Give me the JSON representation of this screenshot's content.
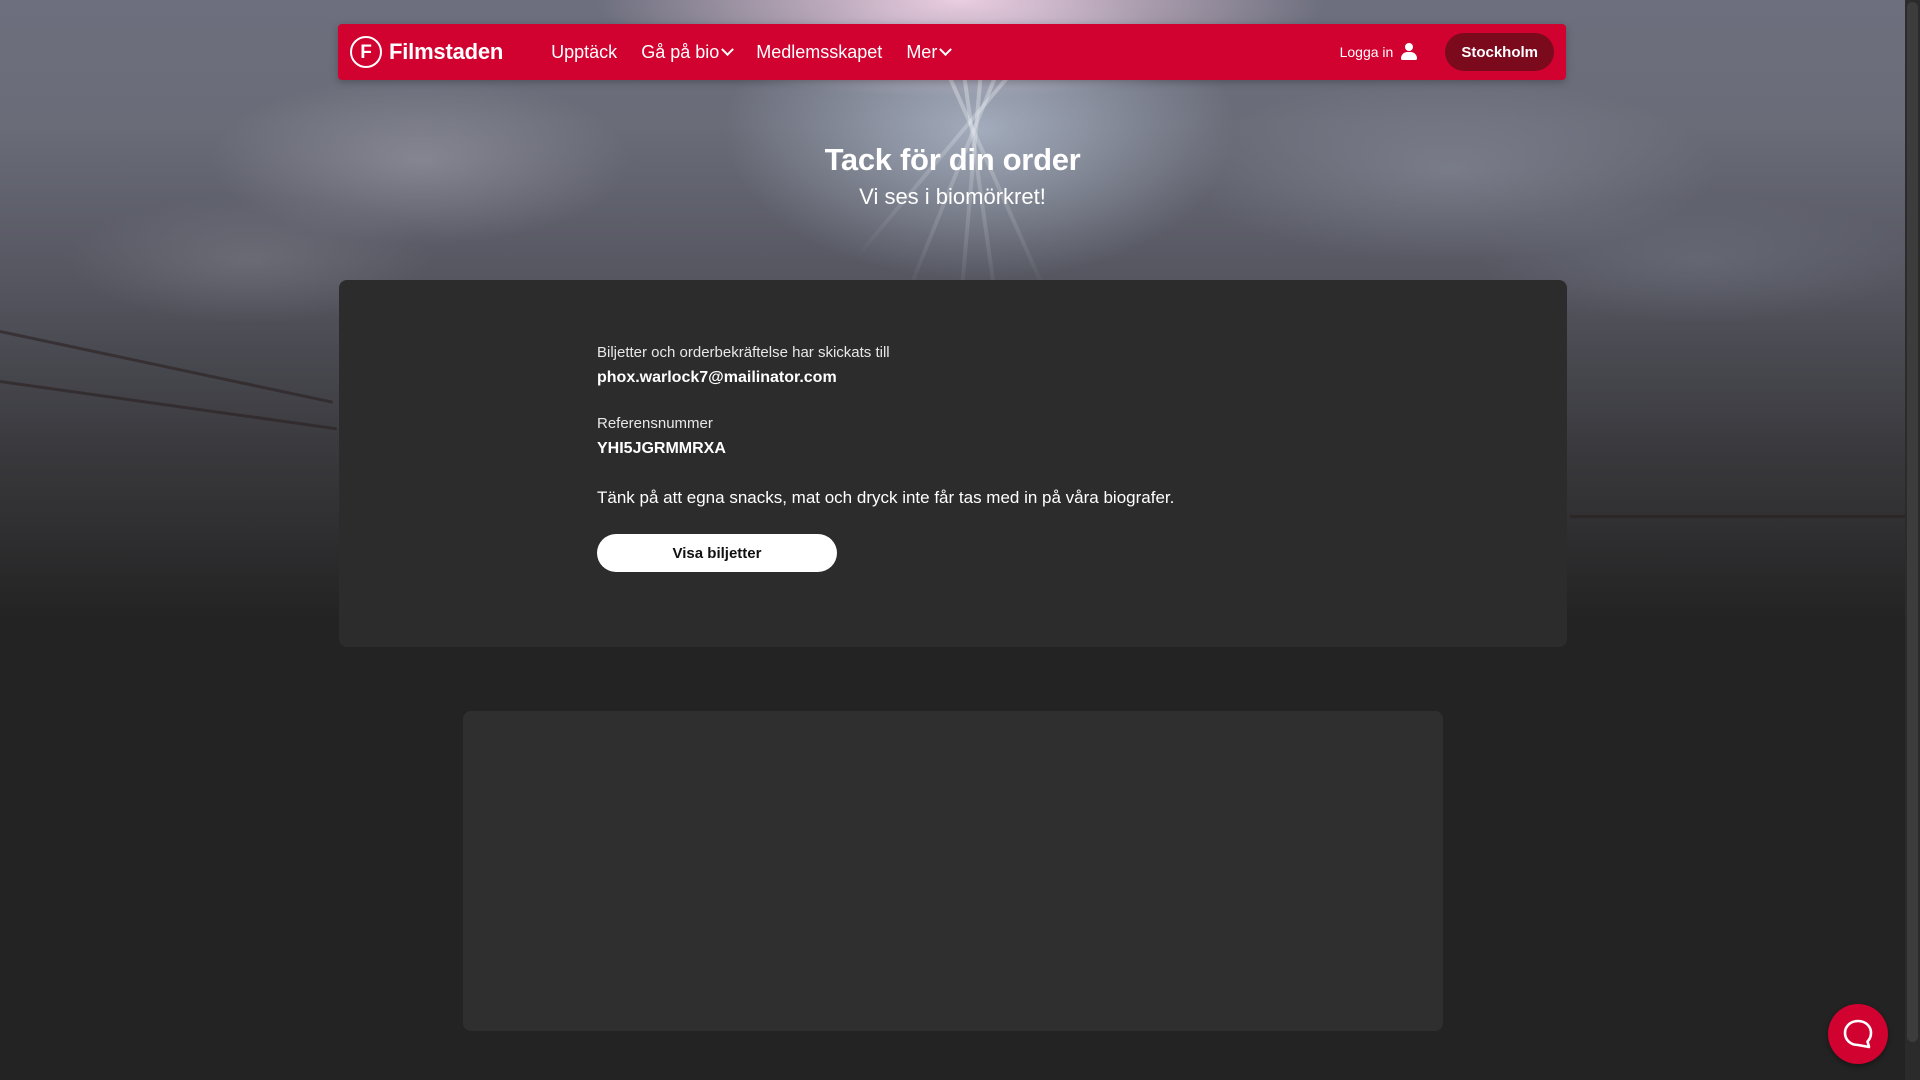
{
  "brand": {
    "name": "Filmstaden",
    "logo_letter": "F",
    "accent_color": "#d1022f"
  },
  "nav": {
    "items": [
      {
        "label": "Upptäck",
        "has_dropdown": false
      },
      {
        "label": "Gå på bio",
        "has_dropdown": true
      },
      {
        "label": "Medlemsskapet",
        "has_dropdown": false
      },
      {
        "label": "Mer",
        "has_dropdown": true
      }
    ],
    "login_label": "Logga in",
    "login_icon": "user-icon",
    "city_label": "Stockholm"
  },
  "hero": {
    "title": "Tack för din order",
    "subtitle": "Vi ses i biomörkret!"
  },
  "confirmation": {
    "sent_to_label": "Biljetter och orderbekräftelse har skickats till",
    "email": "phox.warlock7@mailinator.com",
    "reference_label": "Referensnummer",
    "reference_number": "YHI5JGRMMRXA",
    "notice": "Tänk på att egna snacks, mat och dryck inte får tas med in på våra biografer.",
    "view_tickets_label": "Visa biljetter"
  },
  "chat": {
    "icon": "chat-bubble-icon"
  }
}
